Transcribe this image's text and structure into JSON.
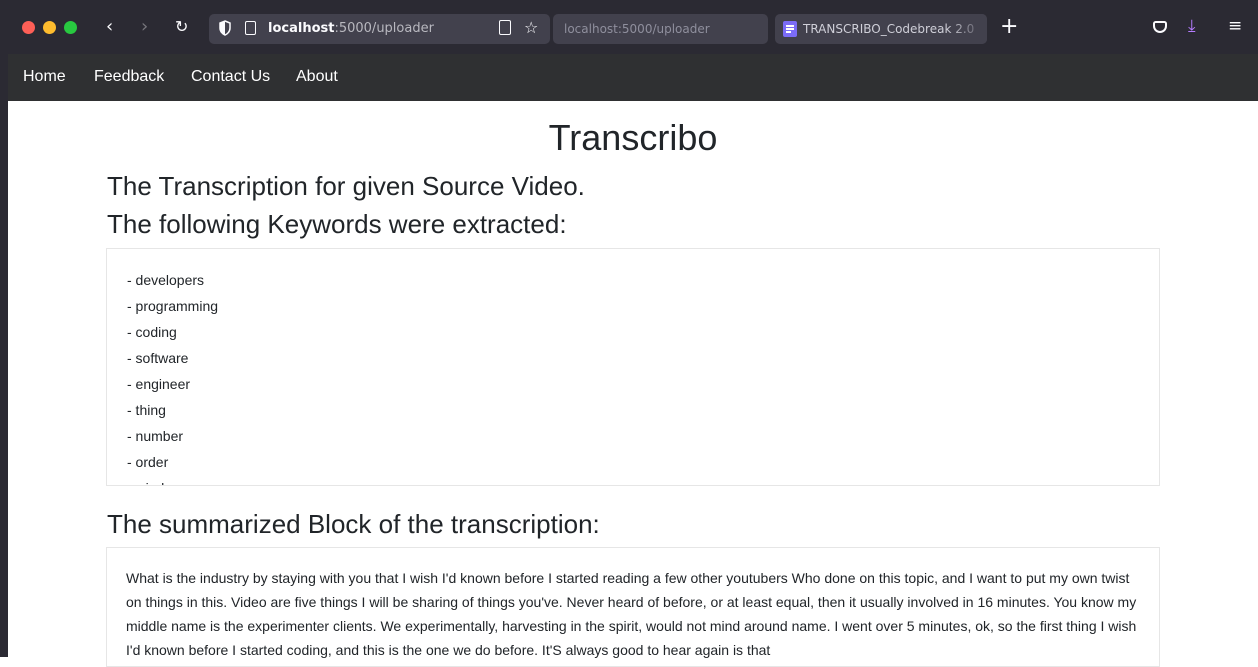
{
  "browser": {
    "url_host": "localhost",
    "url_path": ":5000/uploader",
    "tabs": [
      {
        "label": "localhost:5000/uploader"
      },
      {
        "label": "TRANSCRIBO_Codebreak 2.0"
      }
    ],
    "icons": {
      "back": "‹",
      "forward": "›",
      "reload": "↻",
      "star": "☆",
      "new_tab": "+",
      "download": "⤓",
      "menu": "≡"
    }
  },
  "nav": {
    "items": [
      "Home",
      "Feedback",
      "Contact Us",
      "About"
    ]
  },
  "main": {
    "title": "Transcribo",
    "subtitle": "The Transcription for given Source Video.",
    "keywords_heading": "The following Keywords were extracted:",
    "keywords": [
      "- developers",
      "- programming",
      "- coding",
      "- software",
      "- engineer",
      "- thing",
      "- number",
      "- order",
      "- windows"
    ],
    "summary_heading": "The summarized Block of the transcription:",
    "summary_text": "What is the industry by staying with you that I wish I'd known before I started reading a few other youtubers Who done on this topic, and I want to put my own twist on things in this. Video are five things I will be sharing of things you've. Never heard of before, or at least equal, then it usually involved in 16 minutes. You know my middle name is the experimenter clients. We experimentally, harvesting in the spirit, would not mind around name. I went over 5 minutes, ok, so the first thing I wish I'd known before I started coding, and this is the one we do before. It'S always good to hear again is that"
  },
  "colors": {
    "chrome_bg": "#2b2a33",
    "navbar_bg": "#2f3032",
    "text": "#212529",
    "border": "#e6e6e6"
  }
}
